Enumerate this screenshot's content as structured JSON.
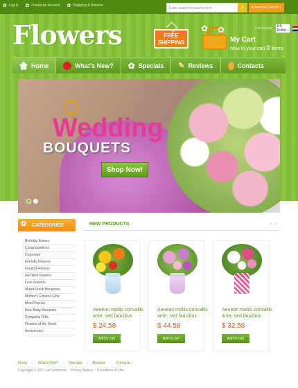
{
  "topbar": {
    "links": [
      {
        "label": "Log in",
        "icon": "flower-icon"
      },
      {
        "label": "Create an Account",
        "icon": "flower-icon"
      },
      {
        "label": "Shipping & Returns",
        "icon": "flower-icon"
      }
    ],
    "search_placeholder": "Enter search keywords here",
    "advanced_search_label": "Advanced Search »"
  },
  "header": {
    "logo_text": "Flowers",
    "free_shipping_line1": "FREE",
    "free_shipping_line2": "SHIPPING",
    "currency_label": "Currencies:",
    "currency_value": "US Dollar",
    "cart_title": "My Cart",
    "cart_status_prefix": "Now in your cart",
    "cart_count": "0",
    "cart_status_suffix": "items"
  },
  "nav": {
    "items": [
      {
        "label": "Home",
        "icon": "home-icon",
        "active": true
      },
      {
        "label": "What's New?",
        "icon": "ladybug-icon",
        "active": false
      },
      {
        "label": "Specials",
        "icon": "flower-icon",
        "active": false
      },
      {
        "label": "Reviews",
        "icon": "pencil-icon",
        "active": false
      },
      {
        "label": "Contacts",
        "icon": "contact-icon",
        "active": false
      }
    ]
  },
  "banner": {
    "title": "Wedding",
    "subtitle": "BOUQUETS",
    "cta": "Shop Now!"
  },
  "sidebar": {
    "heading": "CATEGORIES",
    "items": [
      "Birthday flowers",
      "Congratulations",
      "Corporate",
      "Friendly Flowers",
      "Funeral Flowers",
      "Get Well Flowers",
      "Love Flowers",
      "Mixed Fresh Bouquets",
      "Mother's Flowers Gifts",
      "Most Popular",
      "New Baby Bouquets",
      "Sympathy Gifts",
      "Flowers of the Week",
      "Anniversary"
    ]
  },
  "products": {
    "heading": "NEW PRODUCTS",
    "items": [
      {
        "name": "Aenean mollis convallis ante, sed faucibus",
        "price": "$ 24.58",
        "button": "Add to cart"
      },
      {
        "name": "Aenean mollis convallis ante, sed faucibus",
        "price": "$ 44.58",
        "button": "Add to cart"
      },
      {
        "name": "Aenean mollis convallis ante, sed faucibus",
        "price": "$ 32.58",
        "button": "Add to cart"
      }
    ]
  },
  "footer": {
    "links": [
      "Home",
      "What's New?",
      "Specials",
      "Reviews",
      "Contacts"
    ],
    "copyright": "Copyright © 2011 osCommerce",
    "privacy": "Privacy Notice",
    "conditions": "Conditions of Use"
  },
  "colors": {
    "brand_green": "#8cc63f",
    "accent_orange": "#f28a12",
    "price_orange": "#e2571a",
    "banner_pink": "#e63b95"
  }
}
